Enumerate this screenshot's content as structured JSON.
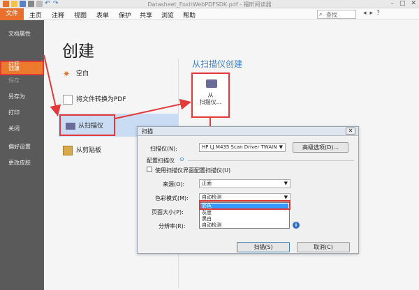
{
  "window": {
    "title": "Datasheet_FoxitWebPDFSDK.pdf - 福昕阅读器"
  },
  "menu": {
    "file": "文件",
    "items": [
      "主页",
      "注释",
      "视图",
      "表单",
      "保护",
      "共享",
      "浏览",
      "帮助"
    ]
  },
  "search": {
    "value": "查找"
  },
  "sidebar": {
    "items": [
      "文档属性",
      "创建",
      "打开",
      "保存",
      "另存为",
      "打印",
      "关闭",
      "偏好设置",
      "更改皮肤"
    ]
  },
  "create": {
    "title": "创建",
    "options": [
      "空白",
      "将文件转换为PDF",
      "从扫描仪",
      "从剪贴板"
    ]
  },
  "scanner_panel": {
    "title": "从扫描仪创建",
    "tile_line1": "从",
    "tile_line2": "扫描仪..."
  },
  "dialog": {
    "title": "扫描",
    "scanner_label": "扫描仪(N):",
    "scanner_value": "HP LJ M435 Scan Driver TWAIN",
    "advanced_button": "高级选项(D)...",
    "section_title": "配置扫描仪",
    "use_ui_checkbox": "使用扫描仪界面配置扫描仪(U)",
    "source_label": "来源(O):",
    "source_value": "正面",
    "color_label": "色彩模式(M):",
    "color_value": "自动检测",
    "color_options": [
      "彩色",
      "灰度",
      "黑白",
      "自动检测"
    ],
    "page_size_label": "页面大小(P):",
    "resolution_label": "分辨率(R):",
    "scan_button": "扫描(S)",
    "cancel_button": "取消(C)"
  },
  "colors": {
    "accent": "#ec7a2d",
    "highlight": "#e23a3a",
    "link_blue": "#3a7fcb",
    "selection": "#3399ff"
  }
}
